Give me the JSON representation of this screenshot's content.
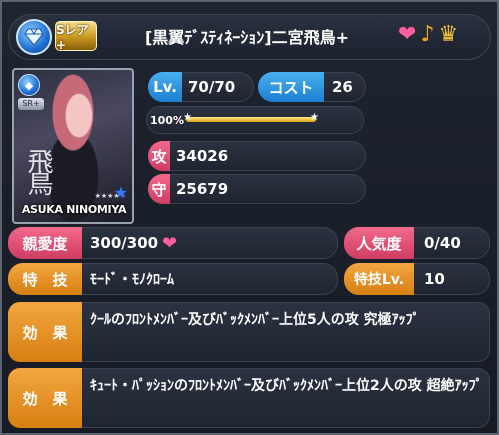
{
  "header": {
    "type_icon": "diamond-icon",
    "rarity_label": "Sレア+",
    "card_name": "[黒翼ﾃﾞｽﾃｨﾈｰｼｮﾝ]二宮飛鳥+",
    "attribute_icons": [
      "heart-icon",
      "note-icon",
      "crown-icon"
    ]
  },
  "portrait": {
    "rarity_label": "SR+",
    "kanji": "飛鳥",
    "name": "ASUKA NINOMIYA",
    "stars": "★",
    "sub": "★★★★☆"
  },
  "stats": {
    "level_label": "Lv.",
    "level_value": "70/70",
    "cost_label": "コスト",
    "cost_value": "26",
    "progress_label": "100%",
    "progress": 1.0,
    "attack_label": "攻",
    "attack_value": "34026",
    "defense_label": "守",
    "defense_value": "25679"
  },
  "info": {
    "affection_label": "親愛度",
    "affection_value": "300/300",
    "affection_icon": "heart-icon",
    "popularity_label": "人気度",
    "popularity_value": "0/40",
    "skill_label": "特　技",
    "skill_value": "ﾓｰﾄﾞ・ﾓﾉｸﾛｰﾑ",
    "skill_level_label": "特技Lv.",
    "skill_level_value": "10"
  },
  "effects": [
    {
      "label": "効　果",
      "text": "ｸｰﾙのﾌﾛﾝﾄﾒﾝﾊﾞｰ及びﾊﾞｯｸﾒﾝﾊﾞｰ上位5人の攻 究極ｱｯﾌﾟ"
    },
    {
      "label": "効　果",
      "text": "ｷｭｰﾄ・ﾊﾟｯｼｮﾝのﾌﾛﾝﾄﾒﾝﾊﾞｰ及びﾊﾞｯｸﾒﾝﾊﾞｰ上位2人の攻 超絶ｱｯﾌﾟ"
    }
  ],
  "colors": {
    "blue": "#1d7ecf",
    "red": "#cf3d62",
    "orange": "#d77f12",
    "gauge": "#d7a50e"
  }
}
